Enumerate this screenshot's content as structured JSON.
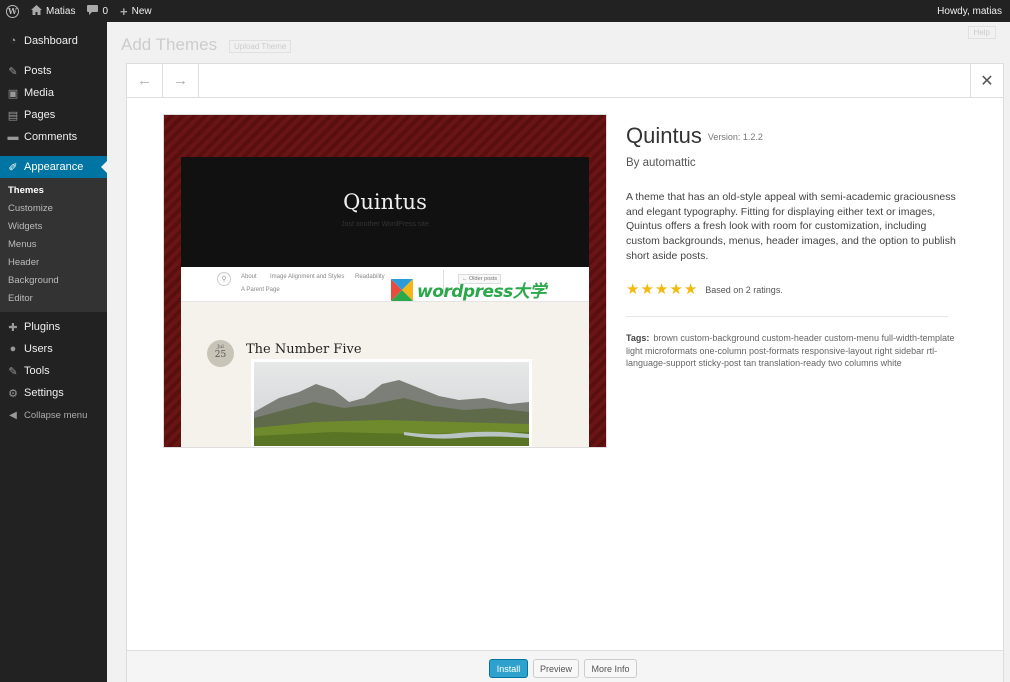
{
  "adminbar": {
    "site_name": "Matias",
    "comments_count": "0",
    "new_label": "New",
    "howdy": "Howdy, matias"
  },
  "sidebar": {
    "items": [
      {
        "label": "Dashboard",
        "icon": "dashboard-icon"
      },
      {
        "label": "Posts",
        "icon": "pin-icon"
      },
      {
        "label": "Media",
        "icon": "media-icon"
      },
      {
        "label": "Pages",
        "icon": "pages-icon"
      },
      {
        "label": "Comments",
        "icon": "comment-icon"
      },
      {
        "label": "Appearance",
        "icon": "brush-icon"
      },
      {
        "label": "Plugins",
        "icon": "plugin-icon"
      },
      {
        "label": "Users",
        "icon": "users-icon"
      },
      {
        "label": "Tools",
        "icon": "wrench-icon"
      },
      {
        "label": "Settings",
        "icon": "settings-icon"
      }
    ],
    "submenu": [
      "Themes",
      "Customize",
      "Widgets",
      "Menus",
      "Header",
      "Background",
      "Editor"
    ],
    "collapse": "Collapse menu"
  },
  "background_page": {
    "title": "Add Themes",
    "upload": "Upload Theme",
    "help": "Help"
  },
  "modal": {
    "prev": "←",
    "next": "→",
    "close": "✕"
  },
  "screenshot": {
    "site_title": "Quintus",
    "tagline": "Just another WordPress site",
    "nav": [
      "About",
      "Image Alignment and Styles",
      "Readability"
    ],
    "parent_page": "A Parent Page",
    "older_posts": "← Older posts",
    "date_month": "Jul",
    "date_day": "25",
    "post_title": "The Number Five",
    "watermark": "wordpress大学"
  },
  "theme": {
    "name": "Quintus",
    "version": "Version: 1.2.2",
    "author": "By automattic",
    "description": "A theme that has an old-style appeal with semi-academic graciousness and elegant typography. Fitting for displaying either text or images, Quintus offers a fresh look with room for customization, including custom backgrounds, menus, header images, and the option to publish short aside posts.",
    "rating_stars": 5,
    "rating_text": "Based on 2 ratings.",
    "tags_label": "Tags:",
    "tags": "brown custom-background custom-header custom-menu full-width-template light microformats one-column post-formats responsive-layout right sidebar rtl-language-support sticky-post tan translation-ready two columns white"
  },
  "footer": {
    "install": "Install",
    "preview": "Preview",
    "more_info": "More Info"
  },
  "colors": {
    "accent": "#0074a2",
    "button_primary": "#2ea2cc",
    "star": "#f2b90f",
    "sidebar_bg": "#222222"
  }
}
